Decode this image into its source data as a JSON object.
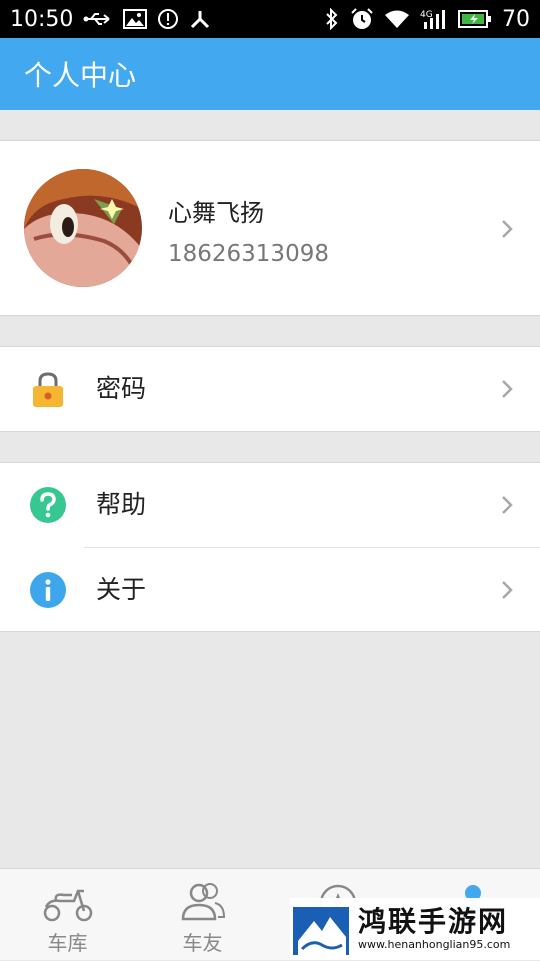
{
  "statusbar": {
    "time": "10:50",
    "battery": "70"
  },
  "header": {
    "title": "个人中心"
  },
  "profile": {
    "name": "心舞飞扬",
    "phone": "18626313098"
  },
  "menu": [
    {
      "label": "密码",
      "icon": "lock-icon"
    },
    {
      "label": "帮助",
      "icon": "help-icon"
    },
    {
      "label": "关于",
      "icon": "info-icon"
    }
  ],
  "tabs": [
    {
      "label": "车库",
      "icon": "scooter-icon"
    },
    {
      "label": "车友",
      "icon": "friends-icon"
    },
    {
      "label": "",
      "icon": "compass-icon"
    },
    {
      "label": "",
      "icon": "person-icon"
    }
  ],
  "watermark": {
    "title": "鸿联手游网",
    "url": "www.henanhonglian95.com"
  },
  "colors": {
    "accent": "#42a8ef",
    "lock": "#f5b731",
    "help": "#37c891",
    "info": "#3ea7ec"
  }
}
